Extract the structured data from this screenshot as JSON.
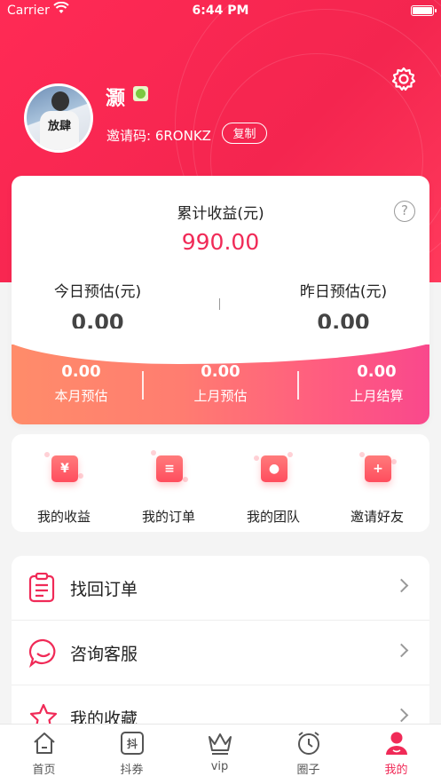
{
  "status_bar": {
    "carrier": "Carrier",
    "time": "6:44 PM"
  },
  "profile": {
    "name": "灏",
    "invite_label": "邀请码: 6RONKZ",
    "copy_label": "复制",
    "avatar_text": "放肆"
  },
  "earnings": {
    "total_label": "累计收益(元)",
    "total_value": "990.00",
    "help_symbol": "?",
    "today_label": "今日预估(元)",
    "today_value": "0.00",
    "yesterday_label": "昨日预估(元)",
    "yesterday_value": "0.00",
    "band": [
      {
        "value": "0.00",
        "label": "本月预估"
      },
      {
        "value": "0.00",
        "label": "上月预估"
      },
      {
        "value": "0.00",
        "label": "上月结算"
      }
    ]
  },
  "quick": [
    {
      "label": "我的收益",
      "glyph": "¥",
      "icon": "income-icon"
    },
    {
      "label": "我的订单",
      "glyph": "≡",
      "icon": "orders-icon"
    },
    {
      "label": "我的团队",
      "glyph": "●",
      "icon": "team-icon"
    },
    {
      "label": "邀请好友",
      "glyph": "+",
      "icon": "invite-friend-icon"
    }
  ],
  "menu": [
    {
      "label": "找回订单",
      "icon": "clipboard-icon"
    },
    {
      "label": "咨询客服",
      "icon": "chat-bubble-icon"
    },
    {
      "label": "我的收藏",
      "icon": "star-icon"
    }
  ],
  "tabs": [
    {
      "label": "首页",
      "icon": "home-icon"
    },
    {
      "label": "抖券",
      "icon": "douquan-icon",
      "glyph": "抖"
    },
    {
      "label": "vip",
      "icon": "crown-icon"
    },
    {
      "label": "圈子",
      "icon": "alarm-clock-icon"
    },
    {
      "label": "我的",
      "icon": "person-icon",
      "active": true
    }
  ],
  "colors": {
    "brand": "#f02a57",
    "header": "#f4254f",
    "band_start": "#ff8c6a",
    "band_end": "#f9488c"
  }
}
